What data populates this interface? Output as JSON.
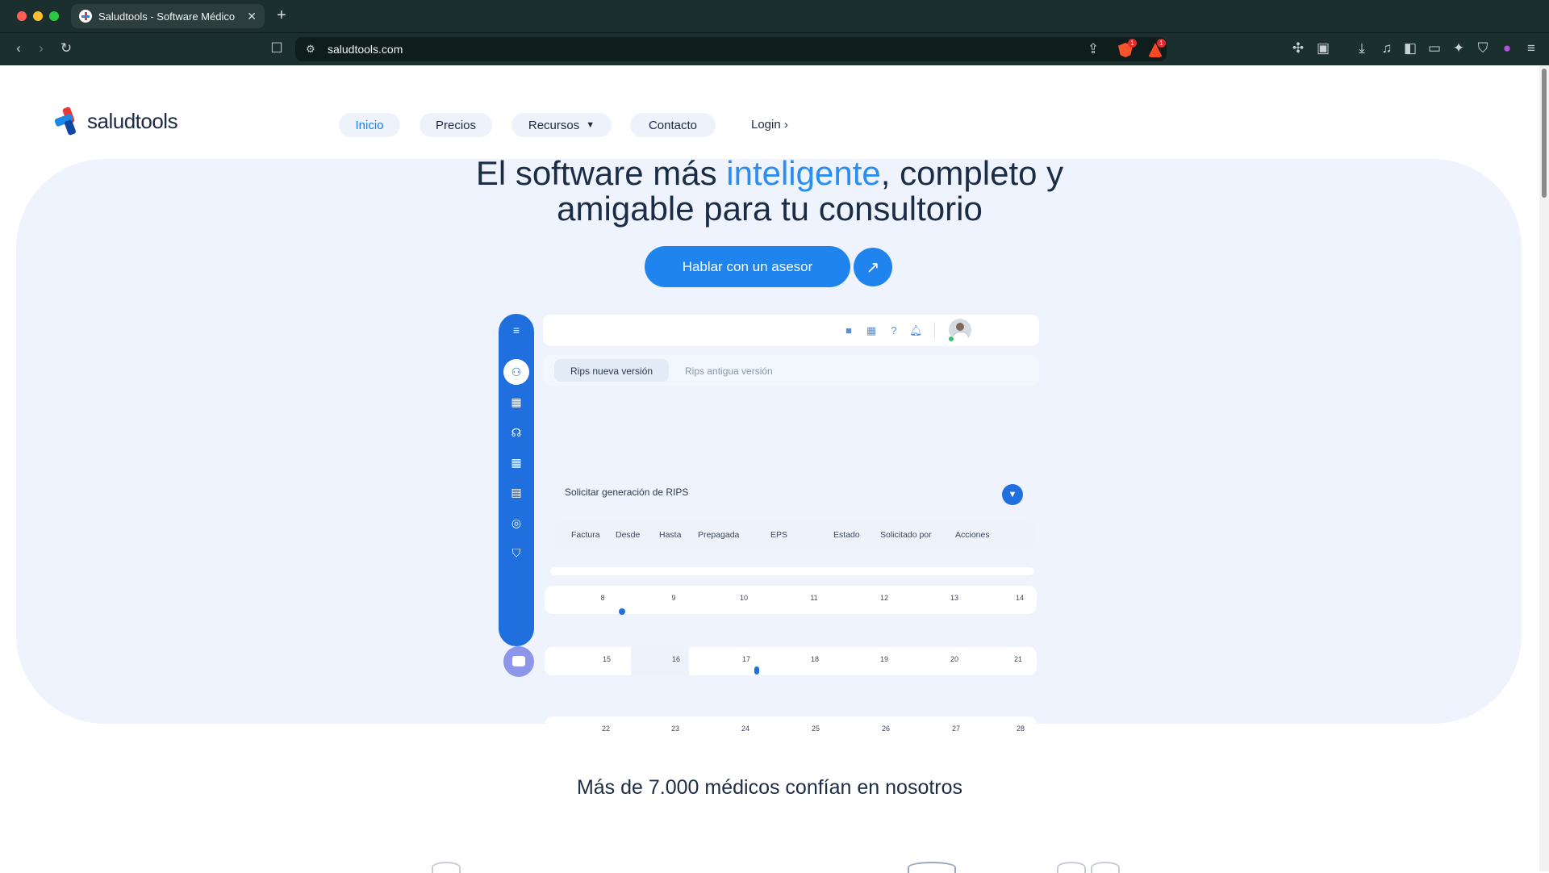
{
  "browser": {
    "tab_title": "Saludtools - Software Médico",
    "tab_close": "✕",
    "new_tab": "+",
    "url": "saludtools.com",
    "shield_count": "1",
    "alert_count": "1"
  },
  "site": {
    "logo_text": "saludtools",
    "nav": {
      "inicio": "Inicio",
      "precios": "Precios",
      "recursos": "Recursos",
      "contacto": "Contacto",
      "login": "Login ›"
    },
    "hero": {
      "title_part1": "El software más ",
      "title_accent": "inteligente",
      "title_part2": ", completo y",
      "title_line2": "amigable para tu consultorio",
      "cta": "Hablar con un asesor",
      "cta_arrow": "↗"
    },
    "trust_text": "Más de 7.000 médicos confían en nosotros"
  },
  "mockup": {
    "tabs": {
      "active": "Rips nueva versión",
      "inactive": "Rips antigua versión"
    },
    "request_title": "Solicitar generación de RIPS",
    "columns": [
      "Factura",
      "Desde",
      "Hasta",
      "Prepagada",
      "EPS",
      "Estado",
      "Solicitado por",
      "Acciones"
    ],
    "calendar_weeks": [
      [
        "8",
        "9",
        "10",
        "11",
        "12",
        "13",
        "14"
      ],
      [
        "15",
        "16",
        "17",
        "18",
        "19",
        "20",
        "21"
      ],
      [
        "22",
        "23",
        "24",
        "25",
        "26",
        "27",
        "28"
      ]
    ]
  },
  "colors": {
    "brand_blue": "#1f84ee",
    "accent_text": "#2a8ef0",
    "hero_bg": "#eef3fd",
    "sidebar_blue": "#1f6fde",
    "chrome_bg": "#1c2f2f"
  }
}
